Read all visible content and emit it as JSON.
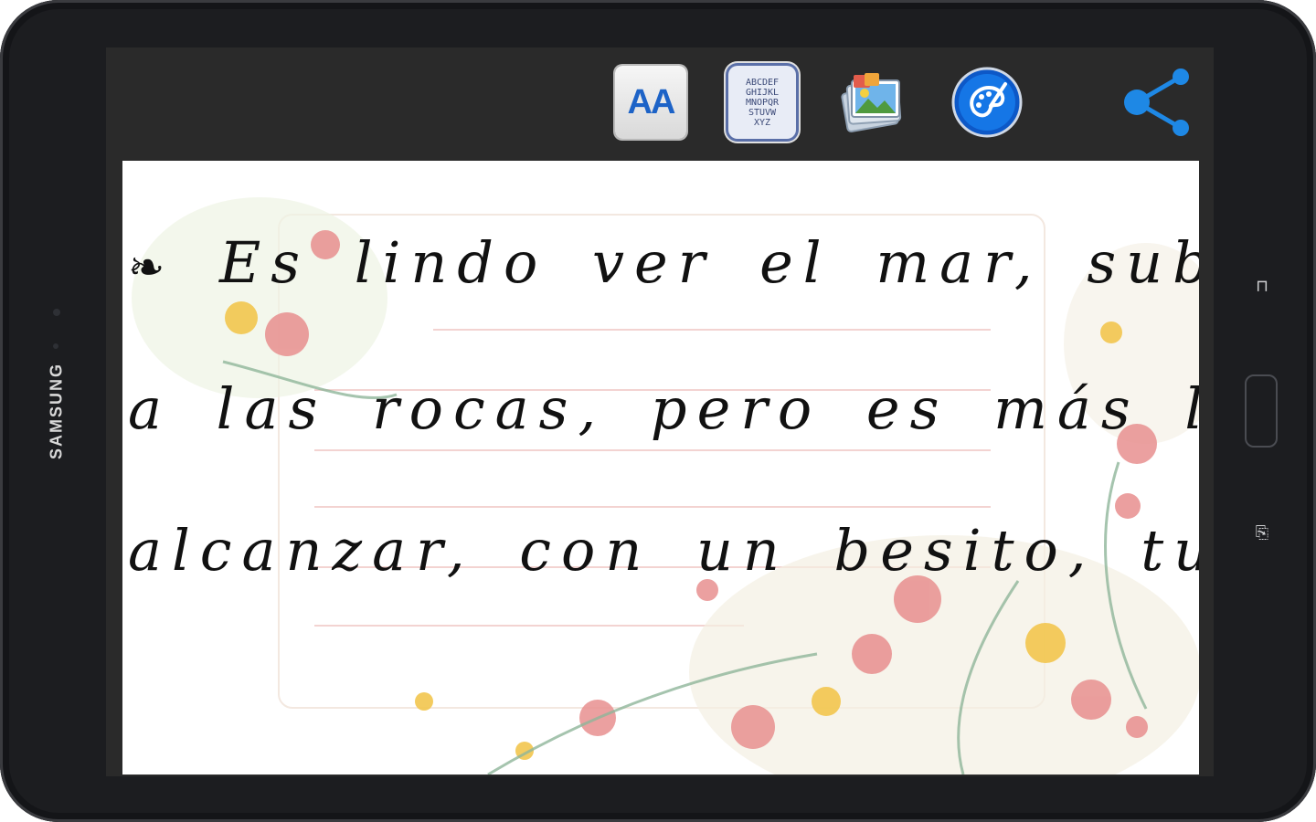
{
  "device": {
    "brand": "SAMSUNG"
  },
  "toolbar": {
    "font_button_label": "AA",
    "alphabet_button_text": "ABCDEF\nGHIJKL\nMNOPQR\nSTUVW\nXYZ",
    "gallery_icon": "gallery-icon",
    "palette_icon": "palette-icon",
    "share_icon": "share-icon"
  },
  "message": {
    "line1": "Es lindo ver el mar, subiéndose",
    "line2": "a las rocas, pero es más lindo",
    "line3": "alcanzar, con un besito, tu boca.",
    "ornament_start": "❧",
    "ornament_end": "❦"
  },
  "colors": {
    "toolbar_bg": "#2a2a2a",
    "accent_blue": "#1e88e5",
    "share_blue": "#1e88e5",
    "ruled_line": "#f3d3d1"
  }
}
